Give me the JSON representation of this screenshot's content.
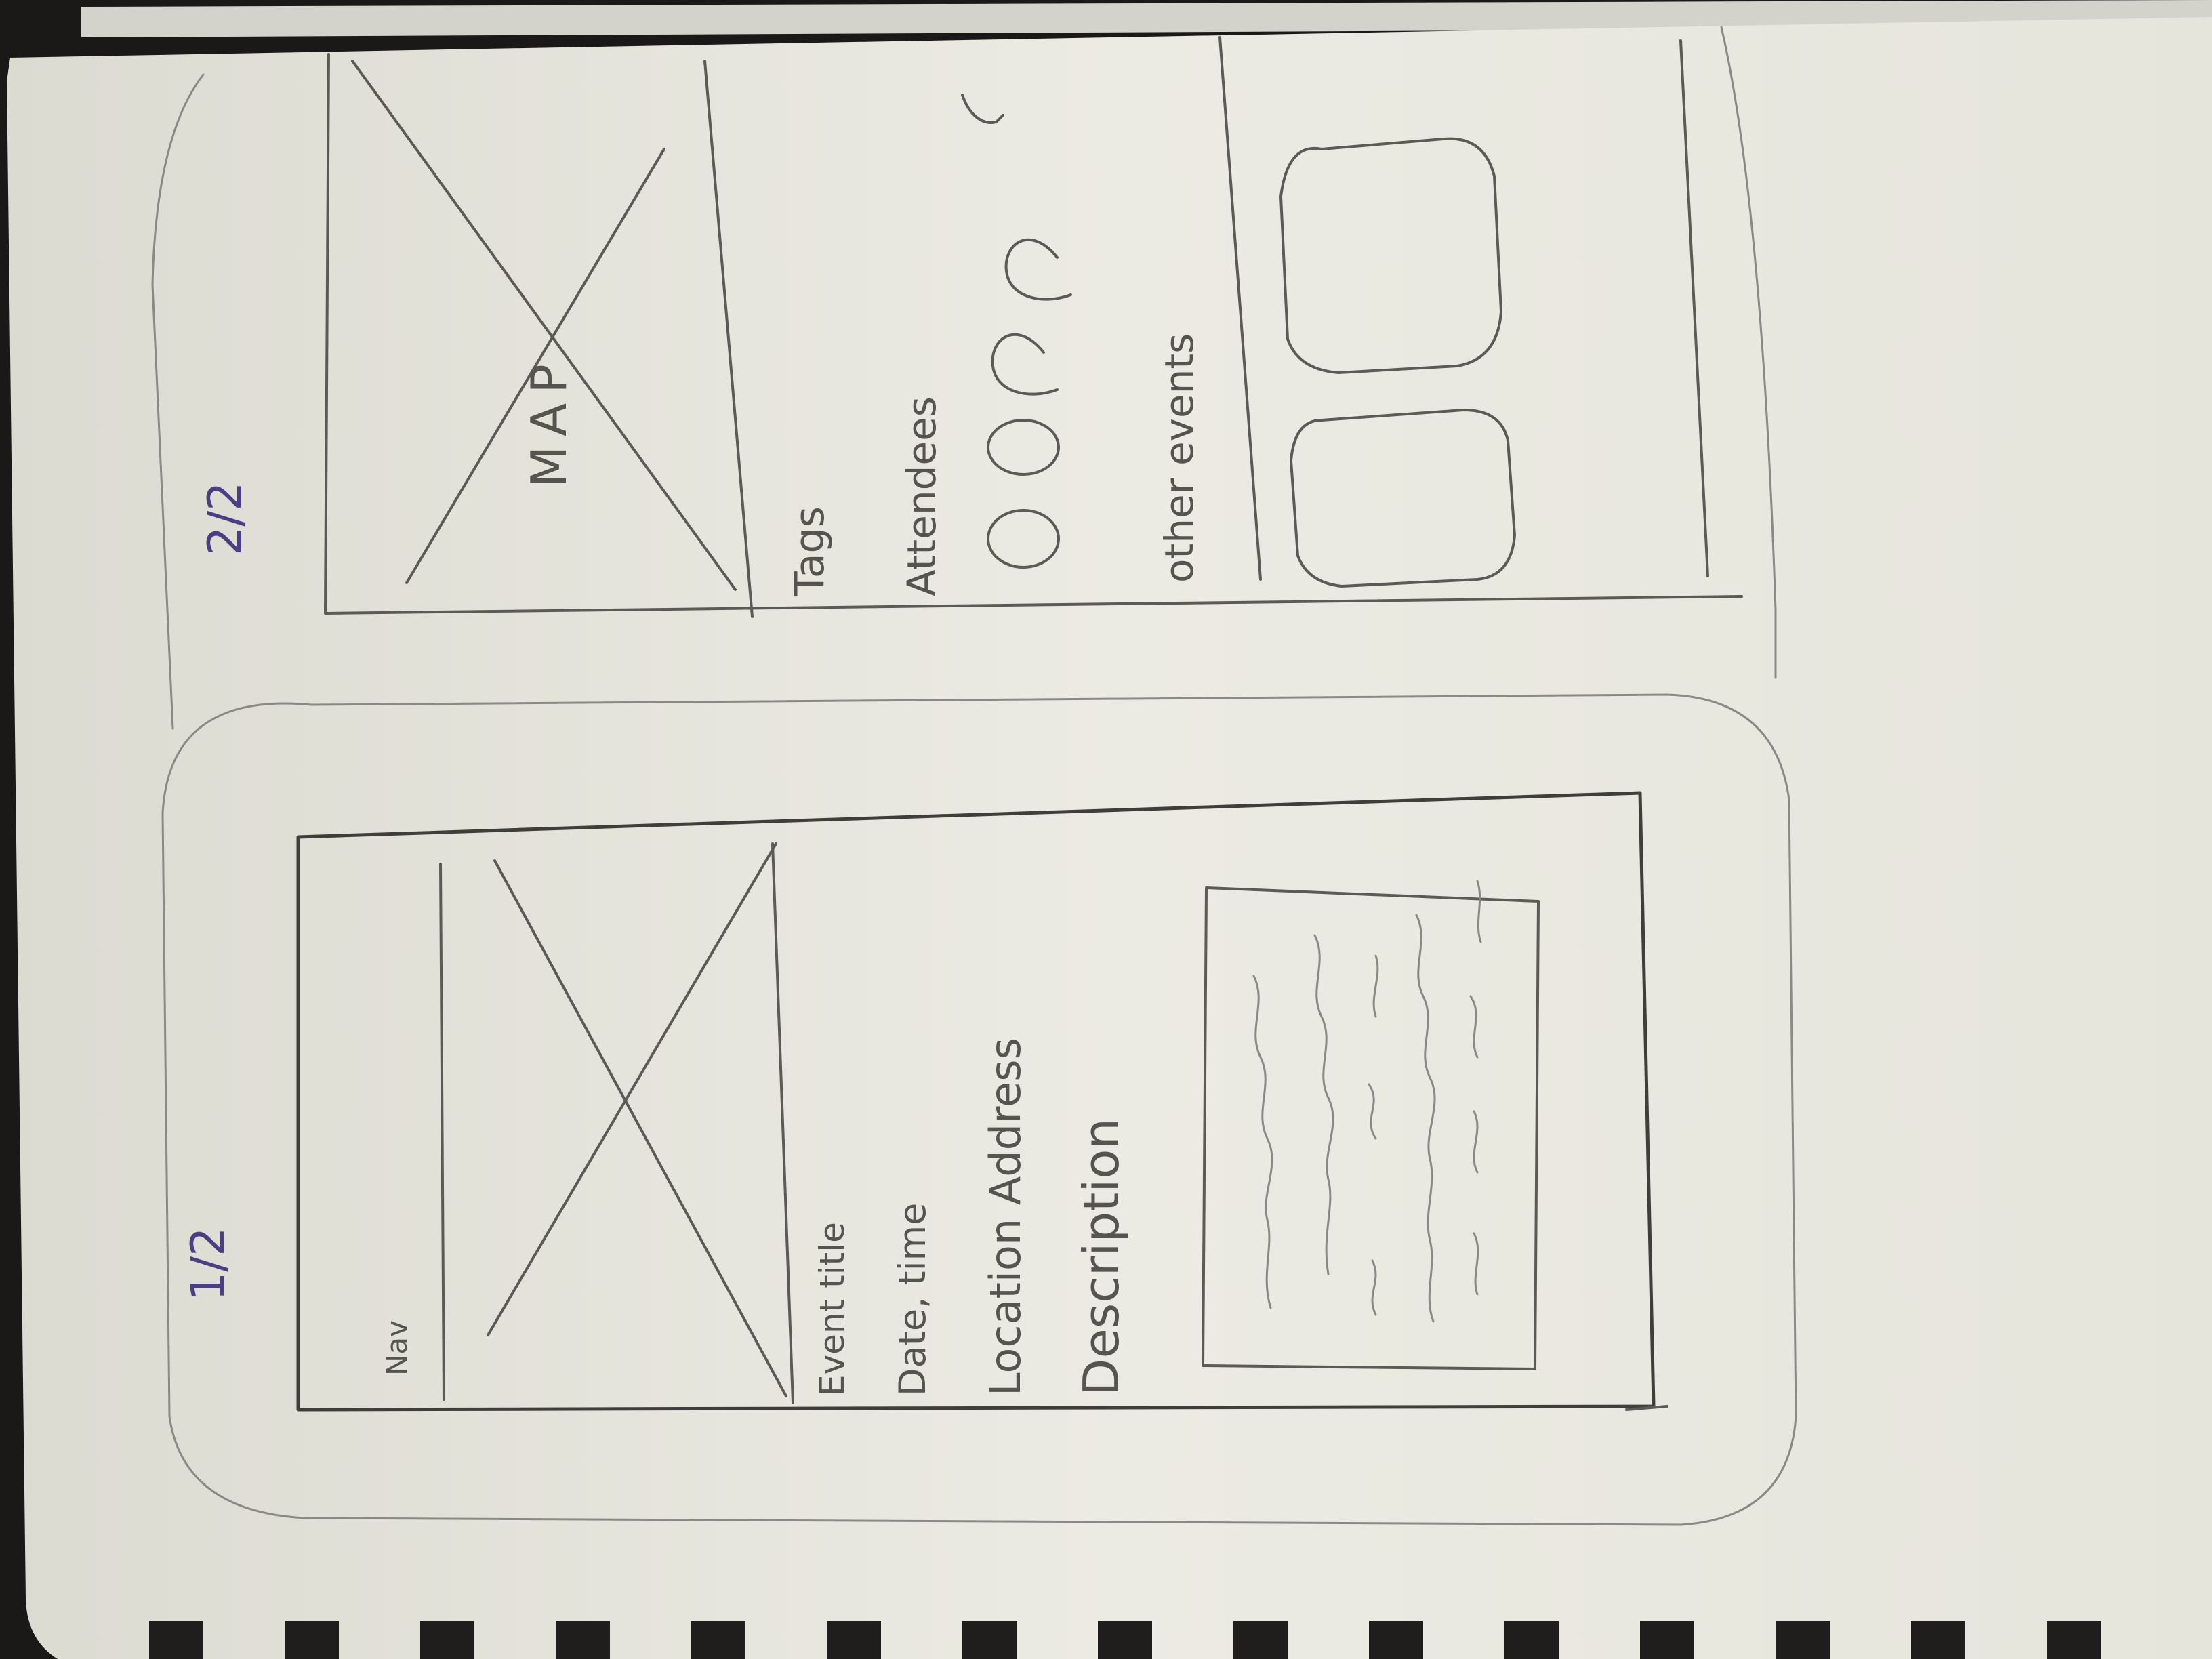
{
  "pages": {
    "first": {
      "label": "1/2"
    },
    "second": {
      "label": "2/2"
    }
  },
  "sketch1": {
    "nav": "Nav",
    "event_title": "Event title",
    "date_time": "Date, time",
    "location": "Location Address",
    "description": "Description"
  },
  "sketch2": {
    "map": "MAP",
    "tags": "Tags",
    "attendees": "Attendees",
    "other_events": "other events"
  },
  "colors": {
    "paper": "#eae9e1",
    "pencil": "#5b5a55",
    "ink": "#4b3f84",
    "binding": "#161513"
  }
}
